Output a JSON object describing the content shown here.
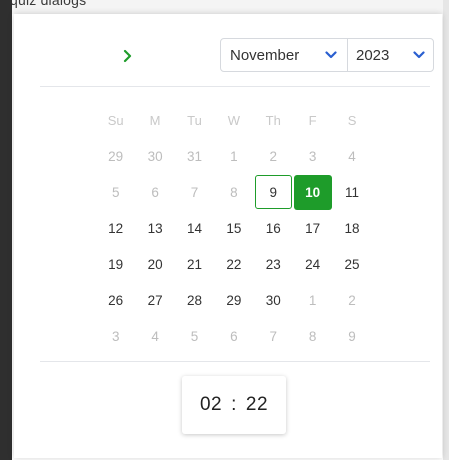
{
  "backdrop": {
    "partial_text": "quiz dialogs"
  },
  "header": {
    "next_month_icon": "chevron-right-icon",
    "month_select": {
      "value": "November",
      "icon": "chevron-down-icon"
    },
    "year_select": {
      "value": "2023",
      "icon": "chevron-down-icon"
    }
  },
  "calendar": {
    "weekdays": [
      "Su",
      "M",
      "Tu",
      "W",
      "Th",
      "F",
      "S"
    ],
    "weeks": [
      [
        {
          "d": "29",
          "m": true
        },
        {
          "d": "30",
          "m": true
        },
        {
          "d": "31",
          "m": true
        },
        {
          "d": "1",
          "m": true
        },
        {
          "d": "2",
          "m": true
        },
        {
          "d": "3",
          "m": true
        },
        {
          "d": "4",
          "m": true
        }
      ],
      [
        {
          "d": "5",
          "m": true
        },
        {
          "d": "6",
          "m": true
        },
        {
          "d": "7",
          "m": true
        },
        {
          "d": "8",
          "m": true
        },
        {
          "d": "9",
          "today": true
        },
        {
          "d": "10",
          "selected": true
        },
        {
          "d": "11"
        }
      ],
      [
        {
          "d": "12"
        },
        {
          "d": "13"
        },
        {
          "d": "14"
        },
        {
          "d": "15"
        },
        {
          "d": "16"
        },
        {
          "d": "17"
        },
        {
          "d": "18"
        }
      ],
      [
        {
          "d": "19"
        },
        {
          "d": "20"
        },
        {
          "d": "21"
        },
        {
          "d": "22"
        },
        {
          "d": "23"
        },
        {
          "d": "24"
        },
        {
          "d": "25"
        }
      ],
      [
        {
          "d": "26"
        },
        {
          "d": "27"
        },
        {
          "d": "28"
        },
        {
          "d": "29"
        },
        {
          "d": "30"
        },
        {
          "d": "1",
          "m": true
        },
        {
          "d": "2",
          "m": true
        }
      ],
      [
        {
          "d": "3",
          "m": true
        },
        {
          "d": "4",
          "m": true
        },
        {
          "d": "5",
          "m": true
        },
        {
          "d": "6",
          "m": true
        },
        {
          "d": "7",
          "m": true
        },
        {
          "d": "8",
          "m": true
        },
        {
          "d": "9",
          "m": true
        }
      ]
    ]
  },
  "time": {
    "hours": "02",
    "separator": ":",
    "minutes": "22"
  },
  "colors": {
    "accent": "#1e9c2a",
    "text": "#333333",
    "muted": "#bdbdbd",
    "border": "#d6d9de"
  }
}
